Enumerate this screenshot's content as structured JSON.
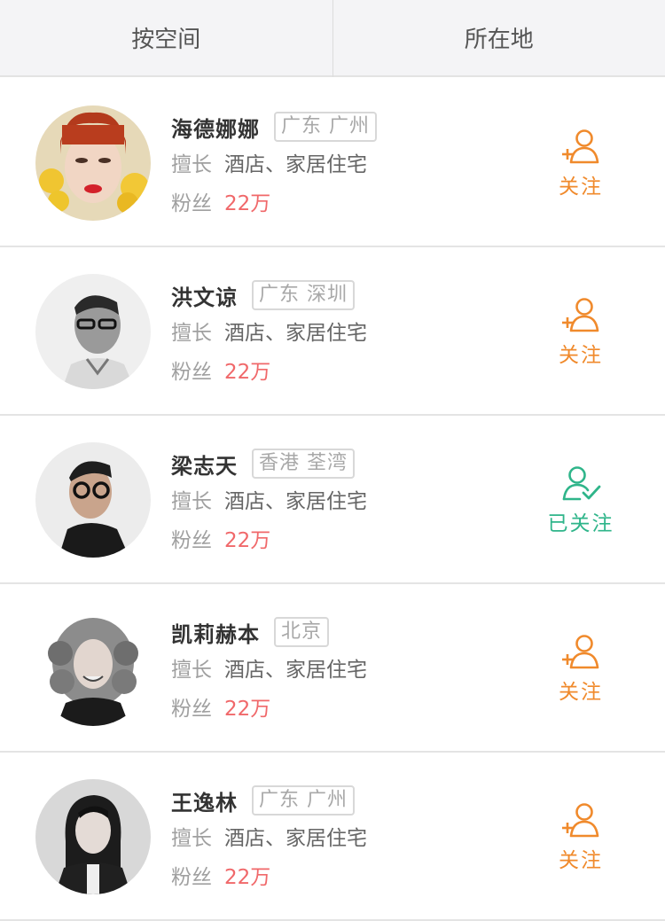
{
  "tabs": [
    {
      "label": "按空间"
    },
    {
      "label": "所在地"
    }
  ],
  "labels": {
    "specialty": "擅长",
    "fans": "粉丝"
  },
  "designers": [
    {
      "name": "海德娜娜",
      "location": "广东 广州",
      "specialty": "酒店、家居住宅",
      "fans": "22万",
      "follow_label": "关注",
      "followed": false
    },
    {
      "name": "洪文谅",
      "location": "广东 深圳",
      "specialty": "酒店、家居住宅",
      "fans": "22万",
      "follow_label": "关注",
      "followed": false
    },
    {
      "name": "梁志天",
      "location": "香港 荃湾",
      "specialty": "酒店、家居住宅",
      "fans": "22万",
      "follow_label": "已关注",
      "followed": true
    },
    {
      "name": "凯莉赫本",
      "location": "北京",
      "specialty": "酒店、家居住宅",
      "fans": "22万",
      "follow_label": "关注",
      "followed": false
    },
    {
      "name": "王逸林",
      "location": "广东 广州",
      "specialty": "酒店、家居住宅",
      "fans": "22万",
      "follow_label": "关注",
      "followed": false
    }
  ],
  "colors": {
    "follow": "#f08a2c",
    "followed": "#2fb58a",
    "fans_value": "#f0686a"
  },
  "icons": {
    "follow": "add-user-icon",
    "followed": "user-check-icon"
  }
}
